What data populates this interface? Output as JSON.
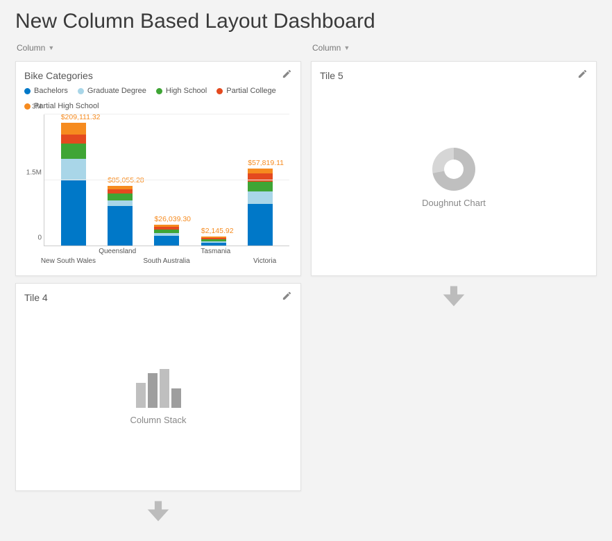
{
  "title": "New Column Based Layout Dashboard",
  "column_header_label": "Column",
  "columns": {
    "left": {
      "tiles": [
        {
          "id": "bike",
          "title": "Bike Categories"
        },
        {
          "id": "tile4",
          "title": "Tile 4",
          "placeholder": "Column Stack"
        }
      ]
    },
    "right": {
      "tiles": [
        {
          "id": "tile5",
          "title": "Tile 5",
          "placeholder": "Doughnut Chart"
        }
      ]
    }
  },
  "colors": {
    "bachelors": "#0078c8",
    "graduate": "#a9d6e8",
    "highschool": "#3fa535",
    "partial_college": "#e44a1f",
    "partial_highschool": "#f68b1f"
  },
  "chart_data": {
    "type": "bar",
    "stacked": true,
    "title": "Bike Categories",
    "yticks": [
      "0",
      "1.5M",
      "3M"
    ],
    "ymax": 3000000,
    "legend": [
      {
        "key": "bachelors",
        "label": "Bachelors"
      },
      {
        "key": "graduate",
        "label": "Graduate Degree"
      },
      {
        "key": "highschool",
        "label": "High School"
      },
      {
        "key": "partial_college",
        "label": "Partial College"
      },
      {
        "key": "partial_highschool",
        "label": "Partial High School"
      }
    ],
    "categories": [
      "New South Wales",
      "Queensland",
      "South Australia",
      "Tasmania",
      "Victoria"
    ],
    "value_labels": [
      "$209,111.32",
      "$85,055.28",
      "$26,039.30",
      "$2,145.92",
      "$57,819.11"
    ],
    "series": [
      {
        "name": "Bachelors",
        "key": "bachelors",
        "values": [
          1500000,
          900000,
          220000,
          70000,
          950000
        ]
      },
      {
        "name": "Graduate Degree",
        "key": "graduate",
        "values": [
          470000,
          130000,
          70000,
          30000,
          280000
        ]
      },
      {
        "name": "High School",
        "key": "highschool",
        "values": [
          350000,
          160000,
          80000,
          40000,
          230000
        ]
      },
      {
        "name": "Partial College",
        "key": "partial_college",
        "values": [
          200000,
          90000,
          60000,
          30000,
          180000
        ]
      },
      {
        "name": "Partial High School",
        "key": "partial_highschool",
        "values": [
          280000,
          80000,
          40000,
          30000,
          120000
        ]
      }
    ]
  }
}
